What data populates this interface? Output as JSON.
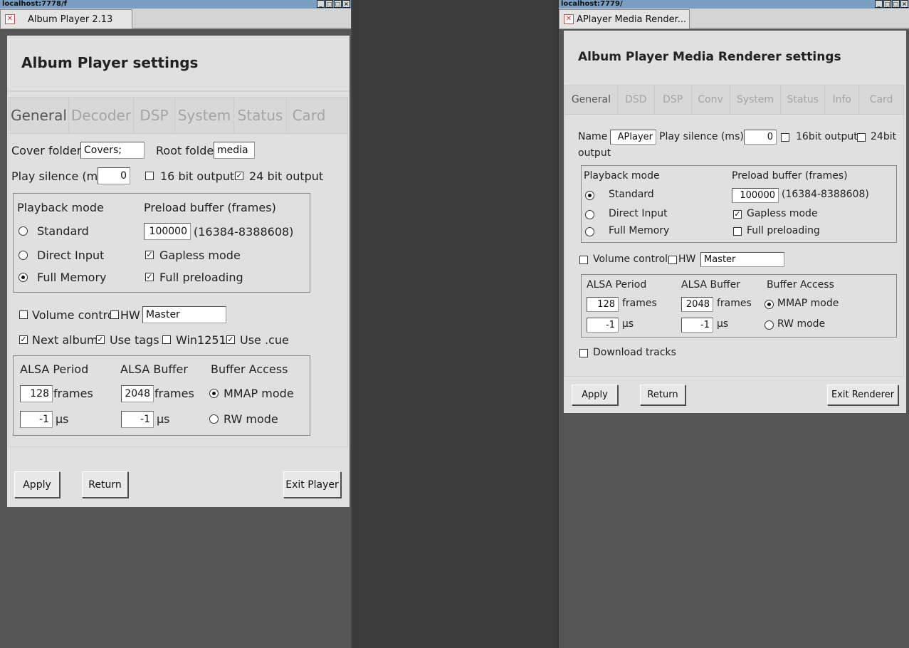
{
  "left": {
    "url": "localhost:7778/f",
    "tab_title": "Album Player 2.13",
    "heading": "Album Player settings",
    "tabs": [
      "General",
      "Decoder",
      "DSP",
      "System",
      "Status",
      "Card"
    ],
    "cover_folders_label": "Cover folders",
    "cover_folders_value": "Covers;",
    "root_folder_label": "Root folder",
    "root_folder_value": "media",
    "play_silence_label": "Play silence (ms)",
    "play_silence_value": "0",
    "out16_label": "16 bit output",
    "out16_checked": false,
    "out24_label": "24 bit output",
    "out24_checked": true,
    "playback_mode_label": "Playback mode",
    "modes": [
      {
        "label": "Standard",
        "selected": false
      },
      {
        "label": "Direct Input",
        "selected": false
      },
      {
        "label": "Full Memory",
        "selected": true
      }
    ],
    "preload_label": "Preload buffer (frames)",
    "preload_value": "100000",
    "preload_range": "(16384-8388608)",
    "gapless_label": "Gapless mode",
    "gapless_checked": true,
    "full_preload_label": "Full preloading",
    "full_preload_checked": true,
    "volume_label": "Volume control",
    "volume_checked": false,
    "hw_label": "HW",
    "hw_checked": false,
    "mixer_value": "Master",
    "next_album_label": "Next album",
    "next_album_checked": true,
    "use_tags_label": "Use tags",
    "use_tags_checked": true,
    "win1251_label": "Win1251",
    "win1251_checked": false,
    "use_cue_label": "Use .cue",
    "use_cue_checked": true,
    "alsa_period_label": "ALSA Period",
    "alsa_buffer_label": "ALSA Buffer",
    "buffer_access_label": "Buffer Access",
    "period_frames": "128",
    "buffer_frames": "2048",
    "frames_unit": "frames",
    "period_us": "-1",
    "buffer_us": "-1",
    "us_unit": "µs",
    "mmap_label": "MMAP mode",
    "mmap_selected": true,
    "rw_label": "RW mode",
    "rw_selected": false,
    "apply_label": "Apply",
    "return_label": "Return",
    "exit_label": "Exit Player"
  },
  "right": {
    "url": "localhost:7779/",
    "tab_title": "APlayer Media Render...",
    "heading": "Album Player Media Renderer settings",
    "tabs": [
      "General",
      "DSD",
      "DSP",
      "Conv",
      "System",
      "Status",
      "Info",
      "Card"
    ],
    "name_label": "Name",
    "name_value": "APlayer",
    "play_silence_label": "Play silence (ms)",
    "play_silence_value": "0",
    "out16_label": "16bit output",
    "out16_checked": false,
    "out24_label": "24bit",
    "out24_wrap": "output",
    "out24_checked": false,
    "playback_mode_label": "Playback mode",
    "modes": [
      {
        "label": "Standard",
        "selected": true
      },
      {
        "label": "Direct Input",
        "selected": false
      },
      {
        "label": "Full Memory",
        "selected": false
      }
    ],
    "preload_label": "Preload buffer (frames)",
    "preload_value": "100000",
    "preload_range": "(16384-8388608)",
    "gapless_label": "Gapless mode",
    "gapless_checked": true,
    "full_preload_label": "Full preloading",
    "full_preload_checked": false,
    "volume_label": "Volume control",
    "volume_checked": false,
    "hw_label": "HW",
    "hw_checked": false,
    "mixer_value": "Master",
    "alsa_period_label": "ALSA Period",
    "alsa_buffer_label": "ALSA Buffer",
    "buffer_access_label": "Buffer Access",
    "period_frames": "128",
    "buffer_frames": "2048",
    "frames_unit": "frames",
    "period_us": "-1",
    "buffer_us": "-1",
    "us_unit": "µs",
    "mmap_label": "MMAP mode",
    "mmap_selected": true,
    "rw_label": "RW mode",
    "rw_selected": false,
    "download_label": "Download tracks",
    "download_checked": false,
    "apply_label": "Apply",
    "return_label": "Return",
    "exit_label": "Exit Renderer"
  },
  "window_buttons": [
    "_",
    "□",
    "□",
    "×"
  ]
}
